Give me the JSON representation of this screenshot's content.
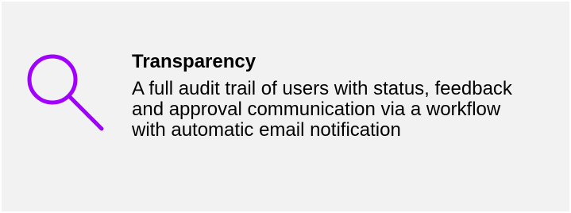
{
  "feature": {
    "icon": "search-icon",
    "accent_color": "#a100ff",
    "title": "Transparency",
    "description": "A full audit trail of users with status, feedback and approval communication via a workflow with automatic email notification"
  },
  "colors": {
    "card_background": "#f2f2f2",
    "text": "#000000"
  }
}
